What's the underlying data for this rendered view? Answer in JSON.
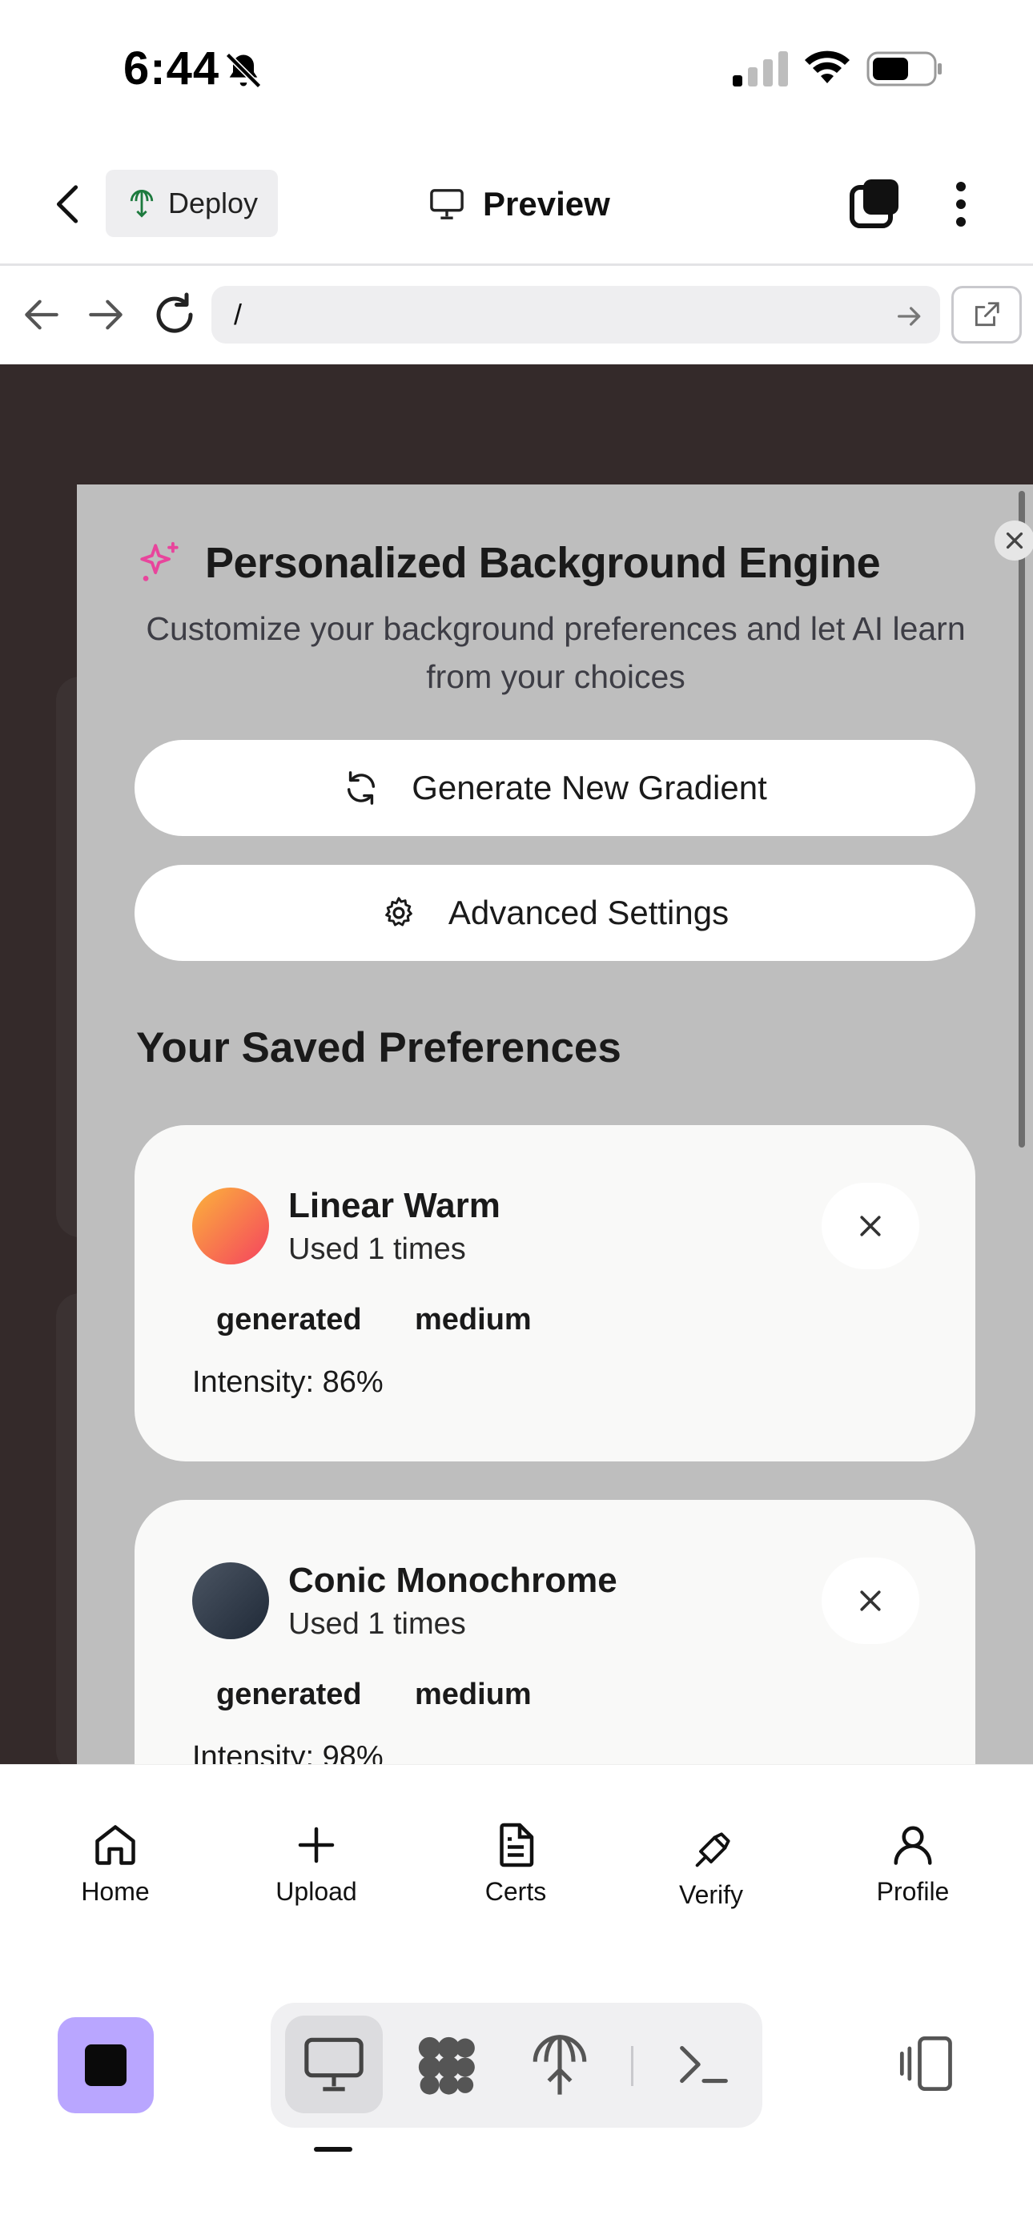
{
  "status_bar": {
    "time": "6:44"
  },
  "app_bar": {
    "deploy_label": "Deploy",
    "preview_label": "Preview"
  },
  "url_bar": {
    "url": "/"
  },
  "panel": {
    "title": "Personalized Background Engine",
    "subtitle": "Customize your background preferences and let AI learn from your choices",
    "generate_label": "Generate New Gradient",
    "advanced_label": "Advanced Settings",
    "section_title": "Your Saved Preferences",
    "preferences": [
      {
        "name": "Linear Warm",
        "used": "Used 1 times",
        "tag1": "generated",
        "tag2": "medium",
        "intensity": "Intensity: 86%",
        "swatch_from": "#fbb33b",
        "swatch_to": "#f5435f"
      },
      {
        "name": "Conic Monochrome",
        "used": "Used 1 times",
        "tag1": "generated",
        "tag2": "medium",
        "intensity": "Intensity: 98%",
        "swatch_from": "#4b5563",
        "swatch_to": "#1f2937"
      }
    ]
  },
  "bottom_nav": {
    "items": [
      {
        "label": "Home"
      },
      {
        "label": "Upload"
      },
      {
        "label": "Certs"
      },
      {
        "label": "Verify"
      },
      {
        "label": "Profile"
      }
    ]
  },
  "colors": {
    "accent_stop": "#b9a6ff",
    "sparkle": "#e8459c",
    "content_bg": "#342a2a"
  }
}
